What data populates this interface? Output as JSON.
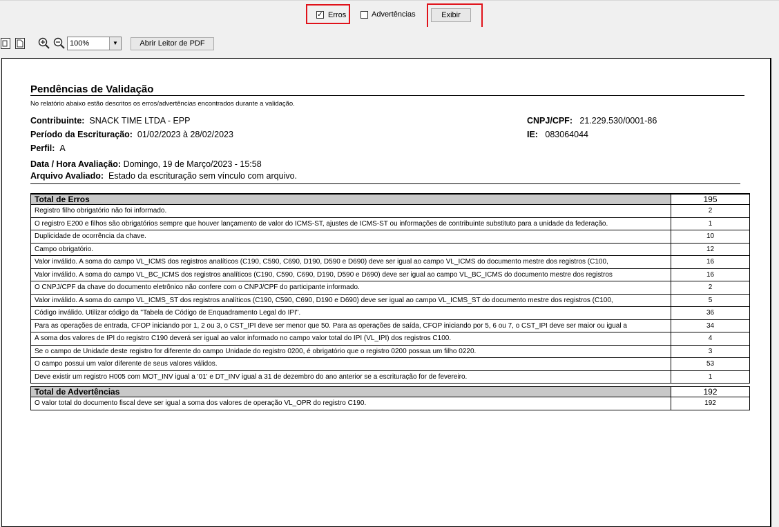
{
  "filters": {
    "erros_label": "Erros",
    "erros_checked": true,
    "advertencias_label": "Advertências",
    "advertencias_checked": false,
    "exibir_label": "Exibir"
  },
  "toolbar": {
    "zoom_value": "100%",
    "open_pdf_label": "Abrir Leitor de PDF"
  },
  "report": {
    "title": "Pendências de Validação",
    "description": "No relatório abaixo estão descritos os erros/advertências encontrados durante a validação.",
    "contribuinte_label": "Contribuinte:",
    "contribuinte_value": "SNACK TIME LTDA - EPP",
    "periodo_label": "Período da Escrituração:",
    "periodo_value": "01/02/2023 à  28/02/2023",
    "perfil_label": "Perfil:",
    "perfil_value": "A",
    "cnpj_label": "CNPJ/CPF:",
    "cnpj_value": "21.229.530/0001-86",
    "ie_label": "IE:",
    "ie_value": "083064044",
    "data_label": "Data / Hora Avaliação:",
    "data_value": "Domingo, 19 de Março/2023 - 15:58",
    "arquivo_label": "Arquivo Avaliado:",
    "arquivo_value": "Estado da escrituração sem vínculo com arquivo."
  },
  "errors": {
    "header": "Total de Erros",
    "total": "195",
    "rows": [
      {
        "text": "Registro filho obrigatório não foi informado.",
        "count": "2"
      },
      {
        "text": "O registro E200 e filhos são obrigatórios sempre que houver lançamento de valor do ICMS-ST, ajustes de ICMS-ST ou informações de contribuinte substituto para a unidade da federação.",
        "count": "1"
      },
      {
        "text": "Duplicidade de ocorrência da chave.",
        "count": "10"
      },
      {
        "text": "Campo obrigatório.",
        "count": "12"
      },
      {
        "text": "Valor inválido. A soma do campo VL_ICMS dos registros analíticos (C190, C590, C690, D190, D590 e D690) deve ser igual ao campo VL_ICMS do documento mestre dos registros (C100,",
        "count": "16"
      },
      {
        "text": "Valor inválido. A soma do campo VL_BC_ICMS dos registros analíticos (C190, C590, C690, D190, D590 e D690) deve ser igual ao campo VL_BC_ICMS do documento mestre dos registros",
        "count": "16"
      },
      {
        "text": "O CNPJ/CPF da chave do documento eletrônico não confere com o CNPJ/CPF do participante informado.",
        "count": "2"
      },
      {
        "text": "Valor inválido. A soma do campo VL_ICMS_ST dos registros analíticos (C190, C590, C690, D190 e D690) deve ser igual ao campo VL_ICMS_ST do documento mestre dos registros (C100,",
        "count": "5"
      },
      {
        "text": "Código inválido. Utilizar código da \"Tabela de Código de Enquadramento Legal do IPI\".",
        "count": "36"
      },
      {
        "text": "Para as operações de entrada, CFOP iniciando por 1, 2 ou 3, o CST_IPI deve ser menor que 50. Para as operações de saída, CFOP iniciando por 5, 6 ou 7, o CST_IPI deve ser maior ou igual a",
        "count": "34"
      },
      {
        "text": "A soma dos valores de IPI do registro C190 deverá ser igual ao valor informado no campo valor total do IPI (VL_IPI) dos registros C100.",
        "count": "4"
      },
      {
        "text": "Se o campo de Unidade deste registro for diferente do campo Unidade do registro 0200, é obrigatório que o registro 0200 possua um filho 0220.",
        "count": "3"
      },
      {
        "text": "O campo possui um valor diferente de seus valores válidos.",
        "count": "53"
      },
      {
        "text": "Deve existir um registro H005 com MOT_INV igual a '01' e DT_INV igual a 31 de dezembro do ano anterior se a escrituração for de fevereiro.",
        "count": "1"
      }
    ]
  },
  "warnings": {
    "header": "Total de Advertências",
    "total": "192",
    "rows": [
      {
        "text": "O valor total do documento fiscal deve ser igual a soma dos valores de operação VL_OPR do registro C190.",
        "count": "192"
      }
    ]
  }
}
